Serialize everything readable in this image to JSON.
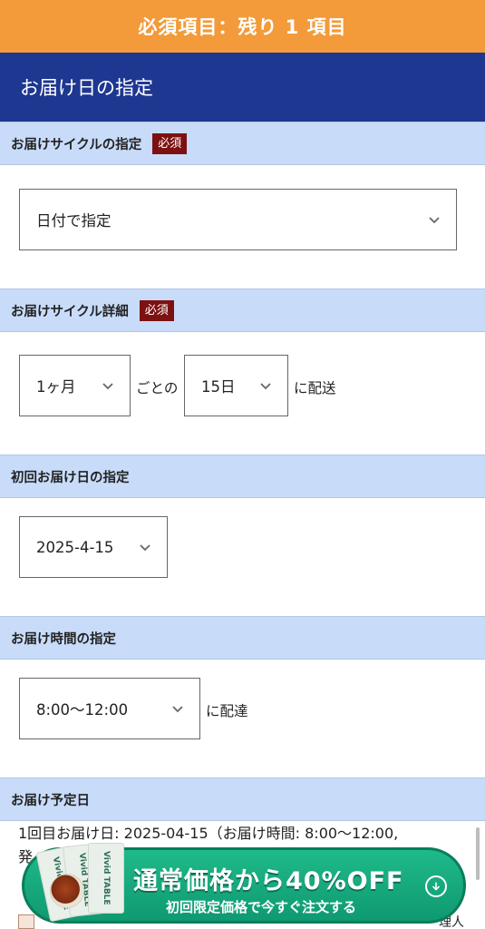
{
  "banner": {
    "text": "必須項目：残り 1 項目"
  },
  "header": {
    "title": "お届け日の指定"
  },
  "required_badge": "必須",
  "sections": {
    "cycle": {
      "title": "お届けサイクルの指定",
      "select_value": "日付で指定"
    },
    "cycle_detail": {
      "title": "お届けサイクル詳細",
      "month_value": "1ヶ月",
      "between_text": "ごとの",
      "day_value": "15日",
      "suffix_text": "に配送"
    },
    "first_date": {
      "title": "初回お届け日の指定",
      "select_value": "2025-4-15"
    },
    "time": {
      "title": "お届け時間の指定",
      "select_value": "8:00〜12:00",
      "suffix_text": "に配達"
    },
    "schedule": {
      "title": "お届け予定日",
      "line1": "1回目お届け日: 2025-04-15（お届け時間: 8:00〜12:00,",
      "line2": "発"
    }
  },
  "promo": {
    "main": "通常価格から40%OFF",
    "sub": "初回限定価格で今すぐ注文する",
    "card_label": "Vivid TABLE"
  },
  "bottom": {
    "right_text": "理人"
  },
  "colors": {
    "banner": "#f39a3a",
    "header": "#1e3791",
    "section_bg": "#c8dcfa",
    "badge": "#7d1111",
    "promo": "#1fb98a"
  }
}
